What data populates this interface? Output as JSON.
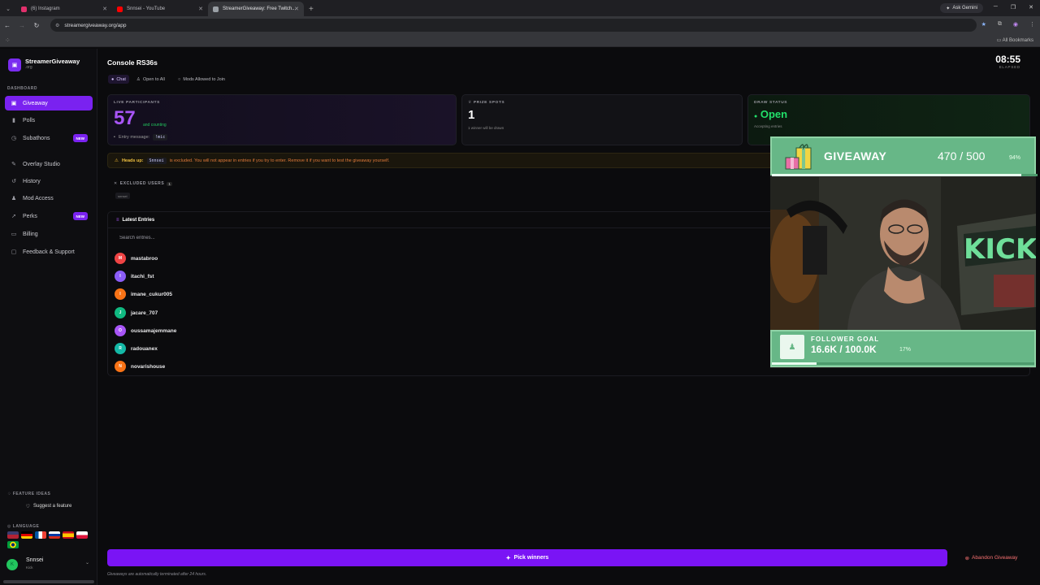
{
  "browser": {
    "tabs": [
      {
        "title": "(6) Instagram",
        "color": "#e1306c"
      },
      {
        "title": "Snnsei - YouTube",
        "color": "#ff0000"
      },
      {
        "title": "StreamerGiveaway: Free Twitch...",
        "color": "#9aa0a6"
      }
    ],
    "gemini_label": "Ask Gemini",
    "url": "streamergiveaway.org/app",
    "all_bookmarks": "All Bookmarks"
  },
  "sidebar": {
    "brand_name": "StreamerGiveaway",
    "brand_sub": ".org",
    "section_dashboard": "DASHBOARD",
    "items": [
      {
        "label": "Giveaway",
        "icon": "gift-icon",
        "active": true
      },
      {
        "label": "Polls",
        "icon": "poll-icon"
      },
      {
        "label": "Subathons",
        "icon": "clock-icon",
        "badge": "NEW"
      },
      {
        "label": "Overlay Studio",
        "icon": "brush-icon"
      },
      {
        "label": "History",
        "icon": "history-icon"
      },
      {
        "label": "Mod Access",
        "icon": "user-icon"
      },
      {
        "label": "Perks",
        "icon": "rocket-icon",
        "badge": "NEW"
      },
      {
        "label": "Billing",
        "icon": "card-icon"
      },
      {
        "label": "Feedback & Support",
        "icon": "chat-icon"
      }
    ],
    "section_feature": "FEATURE IDEAS",
    "suggest_label": "Suggest a feature",
    "section_language": "LANGUAGE",
    "user_name": "Snnsei",
    "user_sub": "Kick"
  },
  "header": {
    "title": "Console RS36s",
    "elapsed_time": "08:55",
    "elapsed_label": "ELAPSED",
    "pills": [
      "Chat",
      "Open to All",
      "Mods Allowed to Join"
    ]
  },
  "cards": {
    "participants_label": "LIVE PARTICIPANTS",
    "participants_count": "57",
    "participants_note": "and counting",
    "entry_message_label": "Entry message:",
    "entry_message_value": "!mic",
    "prize_label": "PRIZE SPOTS",
    "prize_count": "1",
    "prize_note": "1 winner will be drawn",
    "status_label": "DRAW STATUS",
    "status_value": "Open",
    "status_note": "Accepting entries"
  },
  "warning": {
    "prefix": "Heads up:",
    "user": "Snnsei",
    "message": "is excluded. You will not appear in entries if you try to enter. Remove it if you want to test the giveaway yourself."
  },
  "excluded": {
    "title": "EXCLUDED USERS",
    "count": "1",
    "users": [
      "snnsei"
    ]
  },
  "entries": {
    "title": "Latest Entries",
    "search_placeholder": "Search entries...",
    "rows": [
      {
        "initial": "M",
        "name": "mastabroo",
        "color": "#ef4444"
      },
      {
        "initial": "I",
        "name": "itachi_fst",
        "color": "#8b5cf6"
      },
      {
        "initial": "I",
        "name": "imane_cukur005",
        "color": "#f97316"
      },
      {
        "initial": "J",
        "name": "jacare_707",
        "color": "#10b981"
      },
      {
        "initial": "O",
        "name": "oussamajemmane",
        "color": "#a855f7"
      },
      {
        "initial": "R",
        "name": "radouanex",
        "color": "#14b8a6"
      },
      {
        "initial": "N",
        "name": "novarishouse",
        "color": "#f97316"
      }
    ]
  },
  "overlay": {
    "giveaway_title": "GIVEAWAY",
    "giveaway_count": "470 / 500",
    "giveaway_pct": "94%",
    "giveaway_progress": 0.94,
    "follower_label": "FOLLOWER GOAL",
    "follower_value": "16.6K / 100.0K",
    "follower_pct": "17%",
    "follower_progress": 0.17
  },
  "actions": {
    "pick_winners": "Pick winners",
    "abandon": "Abandon Giveaway",
    "footnote": "Giveaways are automatically terminated after 24 hours."
  }
}
